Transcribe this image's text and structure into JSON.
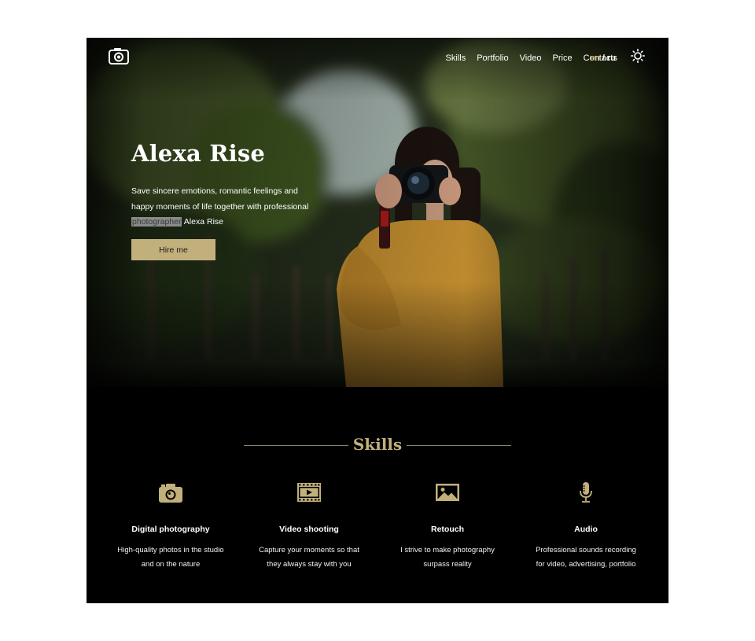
{
  "header": {
    "nav": [
      "Skills",
      "Portfolio",
      "Video",
      "Price",
      "Contacts"
    ],
    "lang_active": "en",
    "lang_other": "/ ru"
  },
  "hero": {
    "title": "Alexa Rise",
    "text_lines": [
      "Save sincere emotions, romantic feelings and",
      "happy moments of life together with professional"
    ],
    "highlight": "photographer",
    "text_tail": " Alexa Rise",
    "button": "Hire me"
  },
  "skills": {
    "title": "Skills",
    "items": [
      {
        "icon": "camera-icon",
        "name": "Digital photography",
        "desc_1": "High-quality photos in the studio",
        "desc_2": "and on the nature"
      },
      {
        "icon": "video-icon",
        "name": "Video shooting",
        "desc_1": "Capture your moments so that",
        "desc_2": "they always stay with you"
      },
      {
        "icon": "image-icon",
        "name": "Retouch",
        "desc_1": "I strive to make photography",
        "desc_2": "surpass reality"
      },
      {
        "icon": "microphone-icon",
        "name": "Audio",
        "desc_1": "Professional sounds recording",
        "desc_2": "for video, advertising, portfolio"
      }
    ]
  },
  "colors": {
    "accent": "#c2b07c",
    "background": "#000000",
    "text": "#ffffff"
  }
}
